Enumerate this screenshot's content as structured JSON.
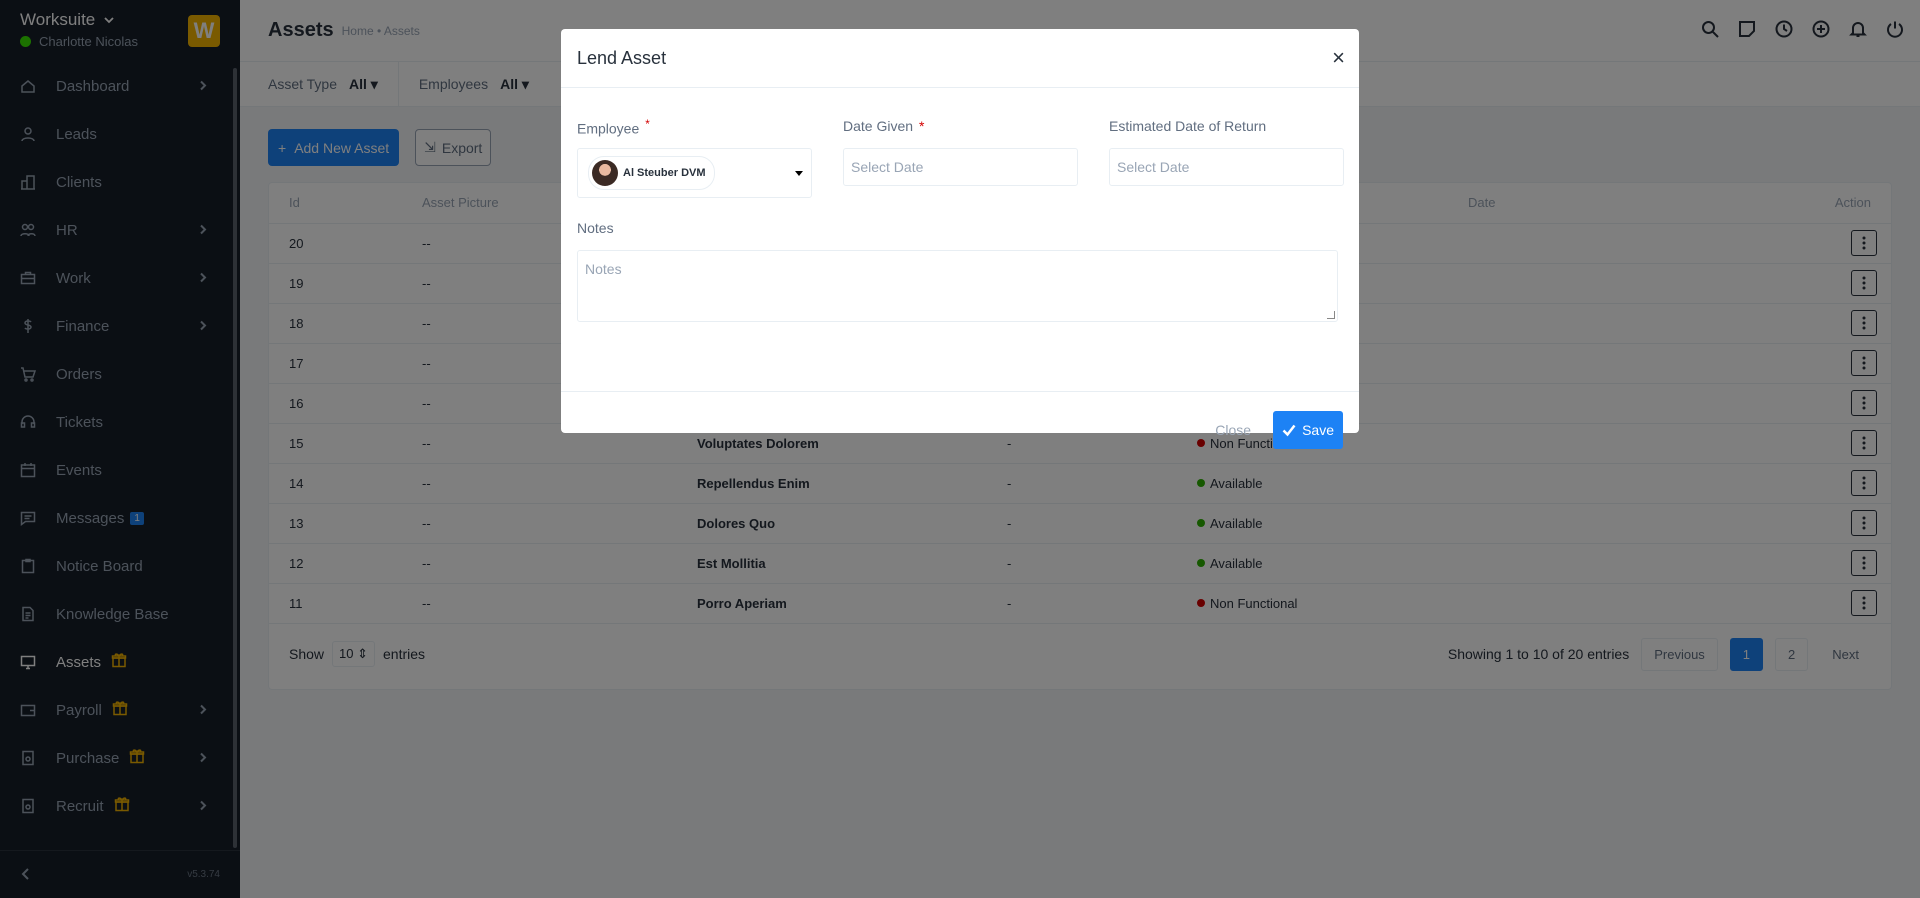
{
  "sidebar": {
    "company": "Worksuite",
    "user": "Charlotte Nicolas",
    "logo_letter": "W",
    "version": "v5.3.74",
    "items": [
      {
        "label": "Dashboard",
        "icon": "house-icon"
      },
      {
        "label": "Leads",
        "icon": "person-icon"
      },
      {
        "label": "Clients",
        "icon": "building-icon"
      },
      {
        "label": "HR",
        "icon": "people-icon"
      },
      {
        "label": "Work",
        "icon": "briefcase-icon"
      },
      {
        "label": "Finance",
        "icon": "dollar-icon"
      },
      {
        "label": "Orders",
        "icon": "cart-icon"
      },
      {
        "label": "Tickets",
        "icon": "headset-icon"
      },
      {
        "label": "Events",
        "icon": "calendar-icon"
      },
      {
        "label": "Messages",
        "icon": "chat-icon",
        "badge": "1"
      },
      {
        "label": "Notice Board",
        "icon": "clipboard-icon"
      },
      {
        "label": "Knowledge Base",
        "icon": "document-icon"
      },
      {
        "label": "Assets",
        "icon": "monitor-icon"
      },
      {
        "label": "Payroll",
        "icon": "wallet-icon"
      },
      {
        "label": "Purchase",
        "icon": "receipt-icon"
      },
      {
        "label": "Recruit",
        "icon": "badge-icon"
      }
    ]
  },
  "header": {
    "title": "Assets",
    "breadcrumb": "Home • Assets"
  },
  "filters": {
    "asset_type_label": "Asset Type",
    "asset_type_value": "All",
    "employees_label": "Employees",
    "employees_value": "All"
  },
  "toolbar": {
    "add_label": "Add New Asset",
    "export_label": "Export"
  },
  "table": {
    "columns": [
      "Id",
      "Asset Picture",
      "Date",
      "Action"
    ],
    "rows": [
      {
        "id": "20",
        "picture": "--",
        "name": "",
        "lent": "",
        "status": ""
      },
      {
        "id": "19",
        "picture": "--",
        "name": "",
        "lent": "",
        "status": ""
      },
      {
        "id": "18",
        "picture": "--",
        "name": "",
        "lent": "",
        "status": ""
      },
      {
        "id": "17",
        "picture": "--",
        "name": "",
        "lent": "",
        "status": ""
      },
      {
        "id": "16",
        "picture": "--",
        "name": "",
        "lent": "",
        "status": ""
      },
      {
        "id": "15",
        "picture": "--",
        "name": "Voluptates Dolorem",
        "lent": "-",
        "status": "Non Functional"
      },
      {
        "id": "14",
        "picture": "--",
        "name": "Repellendus Enim",
        "lent": "-",
        "status": "Available"
      },
      {
        "id": "13",
        "picture": "--",
        "name": "Dolores Quo",
        "lent": "-",
        "status": "Available"
      },
      {
        "id": "12",
        "picture": "--",
        "name": "Est Mollitia",
        "lent": "-",
        "status": "Available"
      },
      {
        "id": "11",
        "picture": "--",
        "name": "Porro Aperiam",
        "lent": "-",
        "status": "Non Functional"
      }
    ],
    "show_label": "Show",
    "show_value": "10",
    "entries_label": "entries",
    "showing_text": "Showing 1 to 10 of 20 entries",
    "prev_label": "Previous",
    "pages": [
      "1",
      "2"
    ],
    "next_label": "Next"
  },
  "modal": {
    "title": "Lend Asset",
    "close_x": "×",
    "employee_label": "Employee",
    "required_mark": "*",
    "employee_value": "Al Steuber DVM",
    "date_given_label": "Date Given",
    "date_given_placeholder": "Select Date",
    "return_label": "Estimated Date of Return",
    "return_placeholder": "Select Date",
    "notes_label": "Notes",
    "notes_placeholder": "Notes",
    "close_button": "Close",
    "save_button": "Save"
  },
  "colors": {
    "primary": "#1d82f5",
    "sidebar_bg": "#171f29",
    "available": "#2cb100",
    "non_functional": "#d30000",
    "logo": "#f5b400"
  }
}
